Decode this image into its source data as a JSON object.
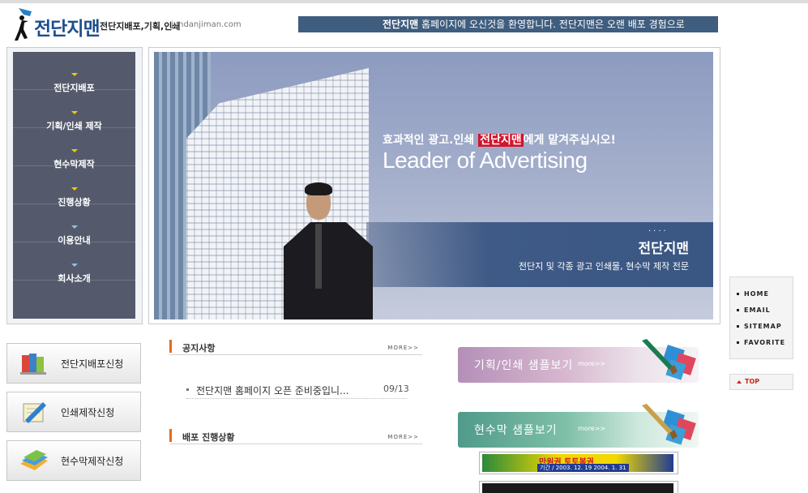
{
  "header": {
    "logo_text": "전단지맨",
    "logo_sub": "전단지배포,기획,인쇄",
    "logo_url": "jundanjiman.com",
    "marquee_brand": "전단지맨",
    "marquee_text": " 홈페이지에 오신것을 환영합니다. 전단지맨은 오랜 배포 경험으로"
  },
  "menu": {
    "items": [
      {
        "label": "전단지배포",
        "arrow": "yellow"
      },
      {
        "label": "기획/인쇄 제작",
        "arrow": "yellow"
      },
      {
        "label": "현수막제작",
        "arrow": "yellow"
      },
      {
        "label": "진행상황",
        "arrow": "yellow"
      },
      {
        "label": "이용안내",
        "arrow": "blue"
      },
      {
        "label": "회사소개",
        "arrow": "blue"
      }
    ]
  },
  "banner": {
    "headline_pre": "효과적인 광고.인쇄",
    "headline_brand": "전단지맨",
    "headline_post": "에게 맡겨주십시오!",
    "tagline": "Leader of Advertising",
    "dots": "....",
    "brand": "전단지맨",
    "brand_sub": "전단지 및 각종 광고 인쇄물, 현수막 제작 전문"
  },
  "quick_menu": {
    "items": [
      "HOME",
      "EMAIL",
      "SITEMAP",
      "FAVORITE"
    ],
    "top_label": "TOP"
  },
  "request_buttons": [
    {
      "label": "전단지배포신청",
      "icon": "books-icon"
    },
    {
      "label": "인쇄제작신청",
      "icon": "pencil-note-icon"
    },
    {
      "label": "현수막제작신청",
      "icon": "folders-icon"
    }
  ],
  "notices": {
    "title": "공지사항",
    "more": "MORE>>",
    "items": [
      {
        "text": "전단지맨 홈페이지 오픈 준비중입니...",
        "date": "09/13"
      }
    ]
  },
  "progress": {
    "title": "배포 진행상황",
    "more": "MORE>>"
  },
  "samples": [
    {
      "label": "기획/인쇄 샘플보기",
      "more": "more>>",
      "color": "#b48fb8"
    },
    {
      "label": "현수막 샘플보기",
      "more": "more>>",
      "color": "#4f9a8a"
    }
  ],
  "ads": [
    {
      "line1": "만원권 토토복권",
      "line2": "기간 / 2003. 12. 19   2004. 1. 31"
    }
  ],
  "colors": {
    "menu_bg": "#545a6b",
    "marquee_bg": "#3f5d7e",
    "accent_red": "#d0152c",
    "section_bar": "#e36c1b"
  }
}
